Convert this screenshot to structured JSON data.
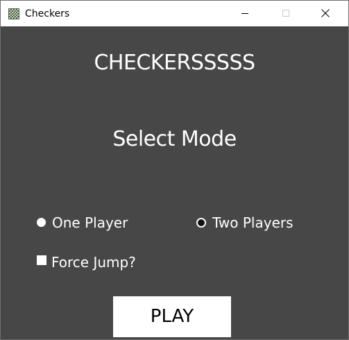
{
  "window": {
    "title": "Checkers",
    "icon": "checkerboard-icon",
    "controls": {
      "minimize_icon": "minimize-icon",
      "maximize_icon": "maximize-icon",
      "close_icon": "close-icon"
    }
  },
  "main": {
    "title": "CHECKERSSSSS",
    "subtitle": "Select Mode",
    "modes": [
      {
        "label": "One Player",
        "selected": true
      },
      {
        "label": "Two Players",
        "selected": false
      }
    ],
    "force_jump": {
      "label": "Force Jump?",
      "checked": false
    },
    "play_label": "PLAY"
  },
  "colors": {
    "background": "#474747",
    "text": "#ffffff",
    "button_bg": "#ffffff",
    "button_text": "#000000"
  }
}
